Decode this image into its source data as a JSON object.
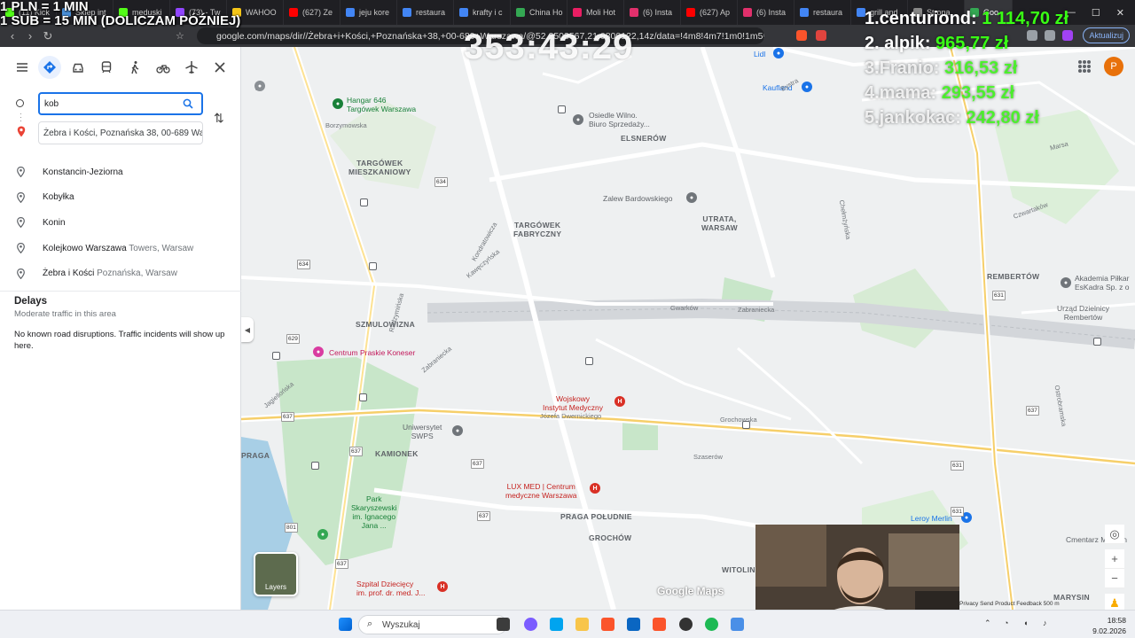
{
  "overlay": {
    "line1": "1 PLN = 1 MIN",
    "line2": "1 SUB = 15 MIN (DOLICZAM PÓŹNIEJ)",
    "timer": "353:43:29",
    "leaderboard": [
      {
        "name": "1.centuriond:",
        "amount": "1 114,70 zł"
      },
      {
        "name": "2. alpik:",
        "amount": "965,77 zł"
      },
      {
        "name": "3.Franio:",
        "amount": "316,53 zł"
      },
      {
        "name": "4.mama:",
        "amount": "293,55 zł"
      },
      {
        "name": "5.jankokac:",
        "amount": "242,80 zł"
      }
    ]
  },
  "browser": {
    "tabs": [
      {
        "label": "(11) Kick",
        "color": "#53fc18"
      },
      {
        "label": "Sklep int",
        "color": "#4a90d9"
      },
      {
        "label": "meduski",
        "color": "#53fc18"
      },
      {
        "label": "(73) - Tw",
        "color": "#9146ff"
      },
      {
        "label": "WAHOO",
        "color": "#f5c518"
      },
      {
        "label": "(627) Ze",
        "color": "#ff0000"
      },
      {
        "label": "jeju kore",
        "color": "#4285f4"
      },
      {
        "label": "restaura",
        "color": "#4285f4"
      },
      {
        "label": "krafty i c",
        "color": "#4285f4"
      },
      {
        "label": "China Ho",
        "color": "#34a853"
      },
      {
        "label": "Moli Hot",
        "color": "#e91e63"
      },
      {
        "label": "(6) Insta",
        "color": "#e1306c"
      },
      {
        "label": "(627) Ap",
        "color": "#ff0000"
      },
      {
        "label": "(6) Insta",
        "color": "#e1306c"
      },
      {
        "label": "restaura",
        "color": "#4285f4"
      },
      {
        "label": "grill and",
        "color": "#4285f4"
      },
      {
        "label": "Strona",
        "color": "#888888"
      },
      {
        "label": "Goo",
        "color": "#34a853"
      }
    ],
    "url": "google.com/maps/dir//Żebra+i+Kości,+Poznańska+38,+00-689+Warszawa/@52.2503567,21.0800122,14z/data=!4m8!4m7!1m0!1m5!1m1!1s0x...",
    "update_label": "Aktualizuj"
  },
  "maps": {
    "from_value": "kob",
    "to_value": "Żebra i Kości, Poznańska 38, 00-689 Warszawa",
    "suggestions": [
      {
        "main": "Konstancin-Jeziorna",
        "secondary": ""
      },
      {
        "main": "Kobyłka",
        "secondary": ""
      },
      {
        "main": "Konin",
        "secondary": ""
      },
      {
        "main": "Kolejkowo Warszawa",
        "secondary": "Towers, Warsaw"
      },
      {
        "main": "Żebra i Kości",
        "secondary": "Poznańska, Warsaw"
      }
    ],
    "delays": {
      "title": "Delays",
      "subtitle": "Moderate traffic in this area",
      "info": "No known road disruptions. Traffic incidents will show up here."
    },
    "avatar_letter": "P",
    "layers_label": "Layers",
    "logo": "Google Maps",
    "attribution": "Privacy   Send Product Feedback   500 m",
    "map_labels": [
      {
        "text": "TARGÓWEK\nMIESZKANIOWY"
      },
      {
        "text": "TARGÓWEK\nFABRYCZNY"
      },
      {
        "text": "ELSNERÓW"
      },
      {
        "text": "UTRATA,\nWARSAW"
      },
      {
        "text": "SZMULOWIZNA"
      },
      {
        "text": "KAMIONEK"
      },
      {
        "text": "PRAGA POŁUDNIE"
      },
      {
        "text": "GROCHÓW"
      },
      {
        "text": "WITOLIN"
      },
      {
        "text": "REMBERTÓW"
      },
      {
        "text": "MARYSIN"
      },
      {
        "text": "PRAGA"
      }
    ],
    "places": [
      {
        "text": "Hangar 646\nTargówek Warszawa",
        "color": "#188038"
      },
      {
        "text": "Osiedle Wilno.\nBiuro Sprzedaży...",
        "color": "#5f6368"
      },
      {
        "text": "Zalew Bardowskiego",
        "color": "#5f6368"
      },
      {
        "text": "Kaufland",
        "color": "#1a73e8"
      },
      {
        "text": "Lidl",
        "color": "#1a73e8"
      },
      {
        "text": "Centrum Praskie Koneser",
        "color": "#c2185b"
      },
      {
        "text": "Wojskowy\nInstytut Medyczny",
        "color": "#c5221f"
      },
      {
        "text": "Uniwersytet\nSWPS",
        "color": "#5f6368"
      },
      {
        "text": "LUX MED | Centrum\nmedyczne Warszawa",
        "color": "#c5221f"
      },
      {
        "text": "Park\nSkaryszewski\nim. Ignacego\nJana ...",
        "color": "#188038"
      },
      {
        "text": "Szpital Dziecięcy\nim. prof. dr. med. J...",
        "color": "#c5221f"
      },
      {
        "text": "Leroy Merlin",
        "color": "#1a73e8"
      },
      {
        "text": "Cmentarz Marysin",
        "color": "#5f6368"
      },
      {
        "text": "Akademia Piłkar\nEsKadra Sp. z o",
        "color": "#5f6368"
      },
      {
        "text": "Urząd Dzielnicy\nRembertów",
        "color": "#5f6368"
      }
    ],
    "streets": [
      {
        "text": "Borzymowska"
      },
      {
        "text": "Bystra"
      },
      {
        "text": "Kondratowicza"
      },
      {
        "text": "Radzymińska"
      },
      {
        "text": "Zabraniecka"
      },
      {
        "text": "Gwarków"
      },
      {
        "text": "Grochowska"
      },
      {
        "text": "Szaserów"
      },
      {
        "text": "Czwartaków"
      },
      {
        "text": "Marsa"
      },
      {
        "text": "Chełmżyńska"
      },
      {
        "text": "Józefa Dwernickiego"
      },
      {
        "text": "Jagiellońska"
      },
      {
        "text": "Kawęczyńska"
      },
      {
        "text": "Zabraniecka"
      },
      {
        "text": "Ostrobramska"
      }
    ],
    "road_numbers": [
      "634",
      "634",
      "629",
      "637",
      "637",
      "637",
      "637",
      "631",
      "631",
      "637",
      "631",
      "801",
      "637"
    ]
  },
  "taskbar": {
    "search_placeholder": "Wyszukaj",
    "time": "18:58",
    "date": "9.02.2026"
  }
}
